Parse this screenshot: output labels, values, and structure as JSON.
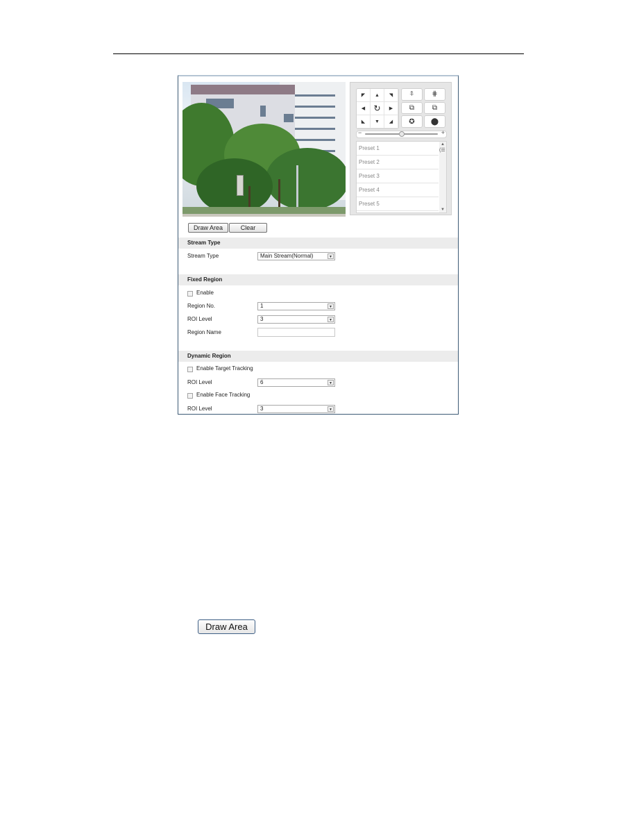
{
  "live_view": {
    "image_alt": "camera-live-view-street-buildings-trees"
  },
  "ptz": {
    "direction_buttons": [
      {
        "name": "up-left",
        "glyph": "◤"
      },
      {
        "name": "up",
        "glyph": "▲"
      },
      {
        "name": "up-right",
        "glyph": "◥"
      },
      {
        "name": "left",
        "glyph": "◀"
      },
      {
        "name": "auto",
        "glyph": "↻"
      },
      {
        "name": "right",
        "glyph": "▶"
      },
      {
        "name": "down-left",
        "glyph": "◣"
      },
      {
        "name": "down",
        "glyph": "▼"
      },
      {
        "name": "down-right",
        "glyph": "◢"
      }
    ],
    "control_buttons": [
      {
        "name": "zoom-in",
        "glyph": "⍏"
      },
      {
        "name": "zoom-out",
        "glyph": "⋕"
      },
      {
        "name": "focus-near",
        "glyph": "⧉"
      },
      {
        "name": "focus-far",
        "glyph": "⧉"
      },
      {
        "name": "iris-open",
        "glyph": "✪"
      },
      {
        "name": "iris-close",
        "glyph": "⬤"
      }
    ],
    "speed_minus": "−",
    "speed_plus": "+",
    "speed_level": 0.5,
    "presets": [
      "Preset 1",
      "Preset 2",
      "Preset 3",
      "Preset 4",
      "Preset 5"
    ]
  },
  "toolbar": {
    "draw_area_label": "Draw Area",
    "clear_label": "Clear"
  },
  "stream_type": {
    "section_title": "Stream Type",
    "field_label": "Stream Type",
    "value": "Main Stream(Normal)"
  },
  "fixed_region": {
    "section_title": "Fixed Region",
    "enable_label": "Enable",
    "enable_checked": false,
    "region_no_label": "Region No.",
    "region_no_value": "1",
    "roi_level_label": "ROI Level",
    "roi_level_value": "3",
    "region_name_label": "Region Name",
    "region_name_value": ""
  },
  "dynamic_region": {
    "section_title": "Dynamic Region",
    "target_tracking_label": "Enable Target Tracking",
    "target_tracking_checked": false,
    "target_roi_label": "ROI Level",
    "target_roi_value": "6",
    "face_tracking_label": "Enable Face Tracking",
    "face_tracking_checked": false,
    "face_roi_label": "ROI Level",
    "face_roi_value": "3"
  },
  "document": {
    "draw_area_button_label": "Draw Area"
  }
}
